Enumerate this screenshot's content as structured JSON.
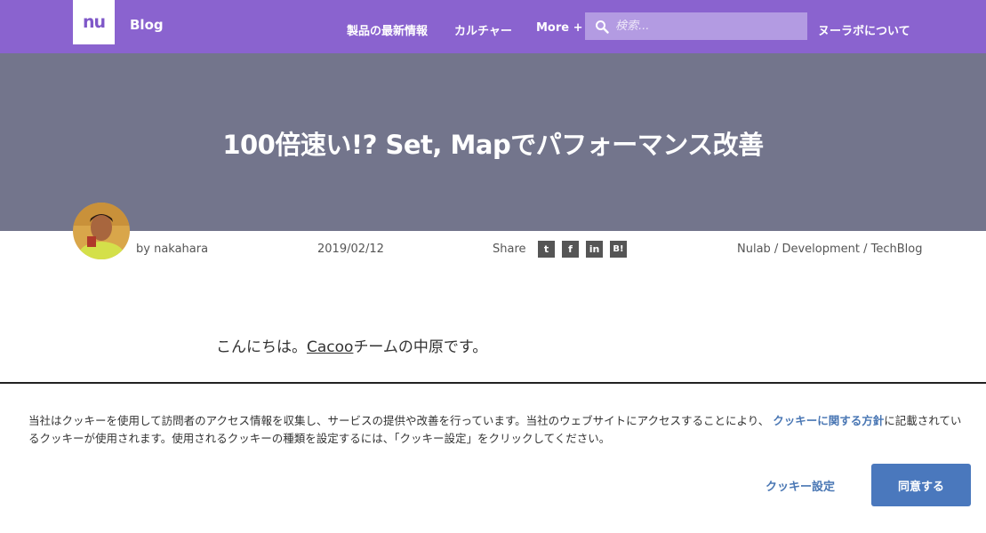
{
  "header": {
    "logo_text": "nu",
    "blog_label": "Blog",
    "nav": [
      {
        "label": "製品の最新情報"
      },
      {
        "label": "カルチャー"
      },
      {
        "label": "More +"
      }
    ],
    "search_placeholder": "検索...",
    "about_label": "ヌーラボについて"
  },
  "article": {
    "title": "100倍速い!? Set, Mapでパフォーマンス改善",
    "author": "by nakahara",
    "date": "2019/02/12",
    "share_label": "Share",
    "share_icons": [
      "twitter-icon",
      "facebook-icon",
      "linkedin-icon",
      "hatena-bookmark-icon"
    ],
    "share_icon_glyphs": [
      "t",
      "f",
      "in",
      "B!"
    ],
    "category": "Nulab / Development / TechBlog",
    "body_prefix": "こんにちは。",
    "body_link": "Cacoo",
    "body_suffix": "チームの中原です。"
  },
  "cookie_banner": {
    "text_before": "当社はクッキーを使用して訪問者のアクセス情報を収集し、サービスの提供や改善を行っています。当社のウェブサイトにアクセスすることにより、",
    "policy_link": "クッキーに関する方針",
    "text_after": "に記載されているクッキーが使用されます。使用されるクッキーの種類を設定するには、「クッキー設定」をクリックしてください。",
    "settings_button": "クッキー設定",
    "agree_button": "同意する"
  },
  "colors": {
    "header_bg": "#8a63cf",
    "hero_bg": "#73758c",
    "link_blue": "#4a77b4",
    "agree_bg": "#4a78bd"
  }
}
